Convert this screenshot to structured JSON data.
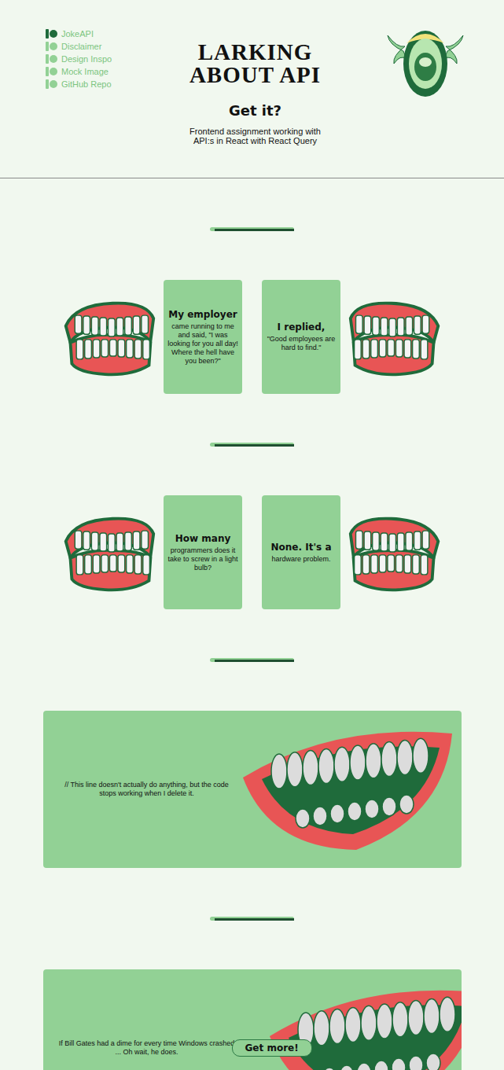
{
  "nav": [
    {
      "label": "JokeAPI",
      "selected": true
    },
    {
      "label": "Disclaimer",
      "selected": false
    },
    {
      "label": "Design Inspo",
      "selected": false
    },
    {
      "label": "Mock Image",
      "selected": false
    },
    {
      "label": "GitHub Repo",
      "selected": false
    }
  ],
  "header": {
    "title_lines": [
      "LARKING",
      "ABOUT API"
    ],
    "tagline": "Get it?",
    "subtitle": "Frontend assignment working with API:s in React with React Query"
  },
  "jokes": [
    {
      "kind": "twopart",
      "setup_head": "My employer",
      "setup_body": "came running to me and said, \"I was looking for you all day! Where the hell have you been?\"",
      "delivery_head": "I replied,",
      "delivery_body": "\"Good employees are hard to find.\""
    },
    {
      "kind": "twopart",
      "setup_head": "How many",
      "setup_body": "programmers does it take to screw in a light bulb?",
      "delivery_head": "None. It's a",
      "delivery_body": "hardware problem."
    },
    {
      "kind": "single",
      "text": "// This line doesn't actually do anything, but the code stops working when I delete it."
    },
    {
      "kind": "single",
      "text": "If Bill Gates had a dime for every time Windows crashed ... Oh wait, he does."
    }
  ],
  "more_button": "Get more!"
}
